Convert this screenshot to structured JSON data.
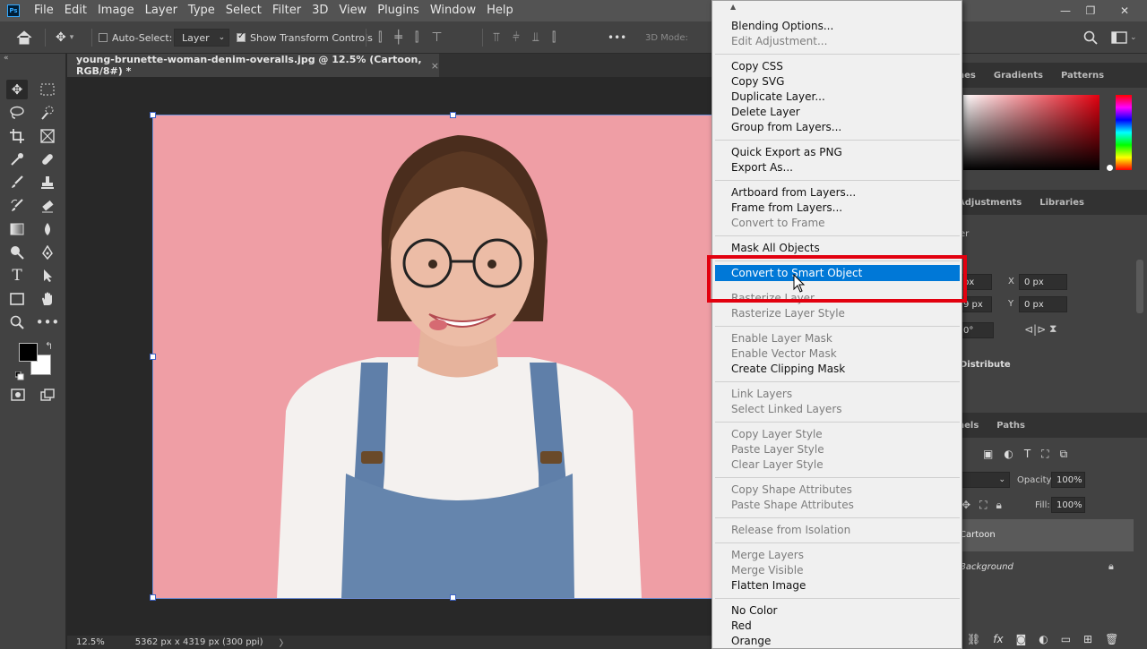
{
  "menubar": {
    "logo": "Ps",
    "items": [
      "File",
      "Edit",
      "Image",
      "Layer",
      "Type",
      "Select",
      "Filter",
      "3D",
      "View",
      "Plugins",
      "Window",
      "Help"
    ]
  },
  "options": {
    "auto_select_label": "Auto-Select:",
    "auto_select_value": "Layer",
    "show_transform_label": "Show Transform Controls",
    "mode_3d_label": "3D Mode:",
    "more": "•••"
  },
  "document": {
    "tab_title": "young-brunette-woman-denim-overalls.jpg @ 12.5% (Cartoon, RGB/8#) *",
    "close": "×",
    "background_color": "#ef9ea5"
  },
  "status": {
    "zoom": "12.5%",
    "info": "5362 px x 4319 px (300 ppi)",
    "arrow": "〉"
  },
  "panels": {
    "color_tabs": [
      "hes",
      "Gradients",
      "Patterns"
    ],
    "props_tabs": [
      "Adjustments",
      "Libraries"
    ],
    "layer_label": "er",
    "w_value": "px",
    "h_value": "9 px",
    "x_label": "X",
    "y_label": "Y",
    "x_value": "0 px",
    "y_value": "0 px",
    "angle": "0°",
    "distribute": "Distribute",
    "layers_tabs": [
      "nels",
      "Paths"
    ],
    "opacity_label": "Opacity:",
    "opacity_value": "100%",
    "fill_label": "Fill:",
    "fill_value": "100%",
    "layer1": "Cartoon",
    "layer2": "Background"
  },
  "context_menu": {
    "highlighted": "Convert to Smart Object",
    "groups": [
      [
        {
          "label": "Blending Options...",
          "enabled": true
        },
        {
          "label": "Edit Adjustment...",
          "enabled": false
        }
      ],
      [
        {
          "label": "Copy CSS",
          "enabled": true
        },
        {
          "label": "Copy SVG",
          "enabled": true
        },
        {
          "label": "Duplicate Layer...",
          "enabled": true
        },
        {
          "label": "Delete Layer",
          "enabled": true
        },
        {
          "label": "Group from Layers...",
          "enabled": true
        }
      ],
      [
        {
          "label": "Quick Export as PNG",
          "enabled": true
        },
        {
          "label": "Export As...",
          "enabled": true
        }
      ],
      [
        {
          "label": "Artboard from Layers...",
          "enabled": true
        },
        {
          "label": "Frame from Layers...",
          "enabled": true
        },
        {
          "label": "Convert to Frame",
          "enabled": false
        }
      ],
      [
        {
          "label": "Mask All Objects",
          "enabled": true
        }
      ],
      [
        {
          "label": "Convert to Smart Object",
          "enabled": true
        },
        {
          "label": "Rasterize Layer",
          "enabled": false
        },
        {
          "label": "Rasterize Layer Style",
          "enabled": false
        }
      ],
      [
        {
          "label": "Enable Layer Mask",
          "enabled": false
        },
        {
          "label": "Enable Vector Mask",
          "enabled": false
        },
        {
          "label": "Create Clipping Mask",
          "enabled": true
        }
      ],
      [
        {
          "label": "Link Layers",
          "enabled": false
        },
        {
          "label": "Select Linked Layers",
          "enabled": false
        }
      ],
      [
        {
          "label": "Copy Layer Style",
          "enabled": false
        },
        {
          "label": "Paste Layer Style",
          "enabled": false
        },
        {
          "label": "Clear Layer Style",
          "enabled": false
        }
      ],
      [
        {
          "label": "Copy Shape Attributes",
          "enabled": false
        },
        {
          "label": "Paste Shape Attributes",
          "enabled": false
        }
      ],
      [
        {
          "label": "Release from Isolation",
          "enabled": false
        }
      ],
      [
        {
          "label": "Merge Layers",
          "enabled": false
        },
        {
          "label": "Merge Visible",
          "enabled": false
        },
        {
          "label": "Flatten Image",
          "enabled": true
        }
      ],
      [
        {
          "label": "No Color",
          "enabled": true
        },
        {
          "label": "Red",
          "enabled": true
        },
        {
          "label": "Orange",
          "enabled": true
        }
      ]
    ]
  },
  "colors": {
    "highlight": "#0078d7",
    "annotation": "#e2000f",
    "foreground": "#000000",
    "background": "#ffffff"
  }
}
